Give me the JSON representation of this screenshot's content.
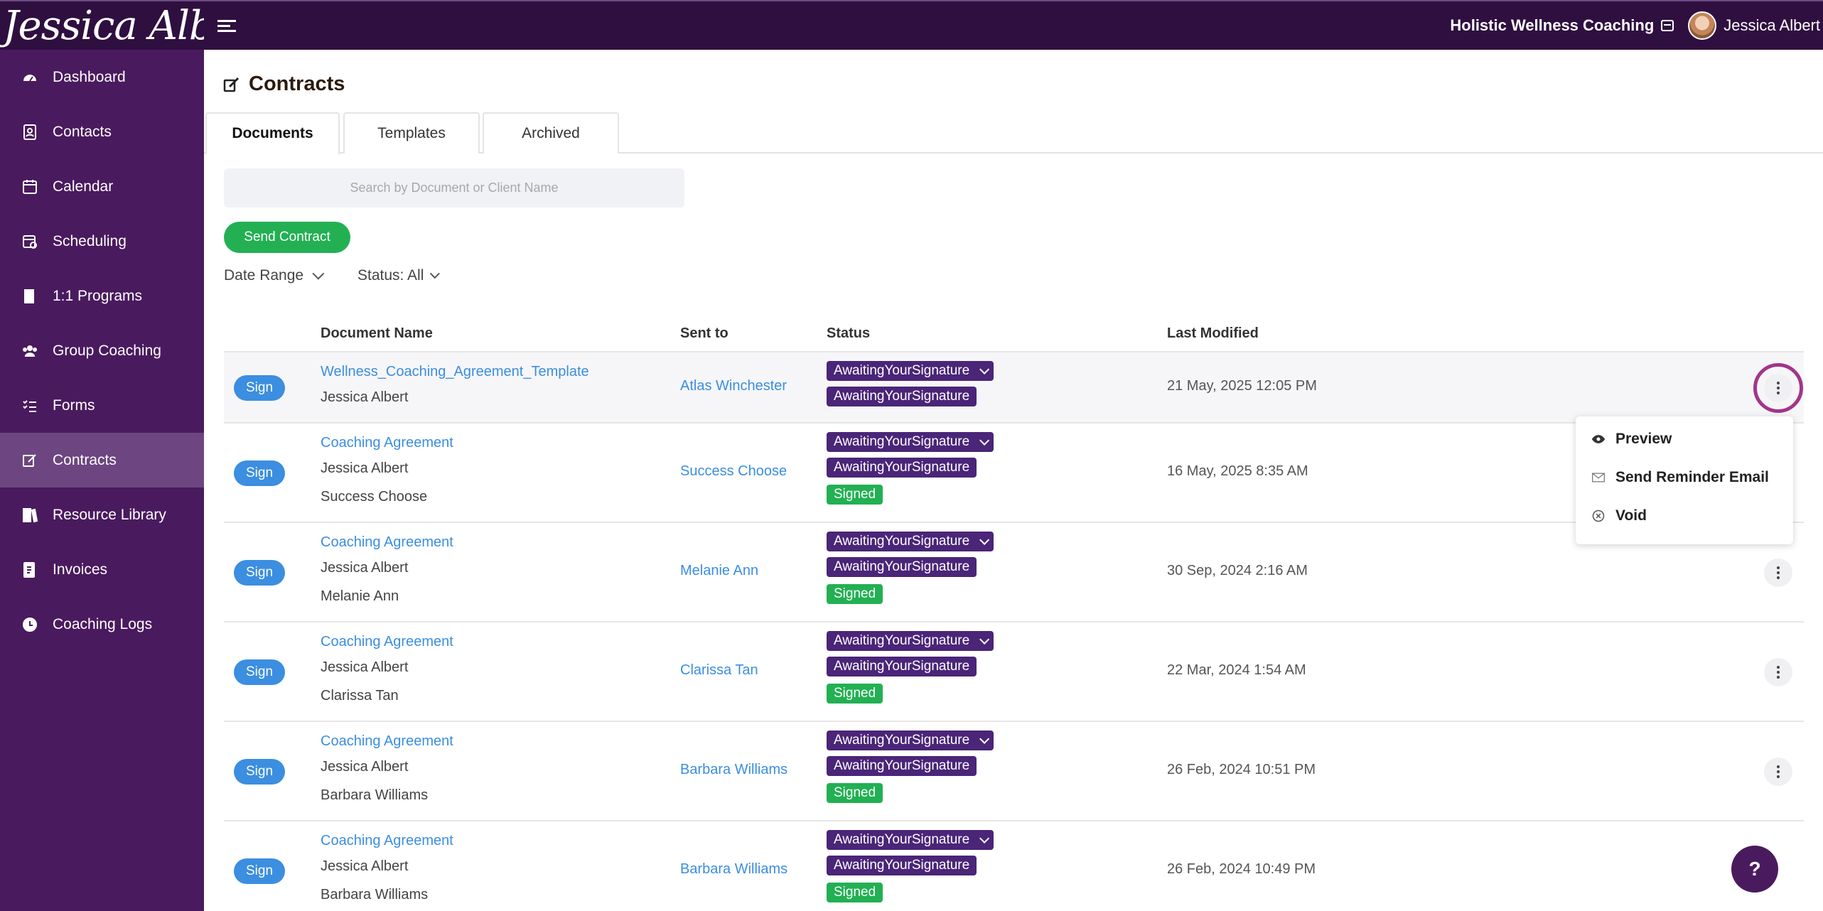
{
  "brand": {
    "name": "Jessica Albert"
  },
  "topbar": {
    "org_name": "Holistic Wellness Coaching",
    "user_name": "Jessica Albert"
  },
  "sidebar": {
    "items": [
      {
        "label": "Dashboard",
        "icon": "gauge-icon"
      },
      {
        "label": "Contacts",
        "icon": "contact-card-icon"
      },
      {
        "label": "Calendar",
        "icon": "calendar-icon"
      },
      {
        "label": "Scheduling",
        "icon": "scheduling-icon"
      },
      {
        "label": "1:1 Programs",
        "icon": "book-icon"
      },
      {
        "label": "Group Coaching",
        "icon": "group-icon"
      },
      {
        "label": "Forms",
        "icon": "checklist-icon"
      },
      {
        "label": "Contracts",
        "icon": "signature-icon",
        "active": true
      },
      {
        "label": "Resource Library",
        "icon": "books-icon"
      },
      {
        "label": "Invoices",
        "icon": "invoice-icon"
      },
      {
        "label": "Coaching Logs",
        "icon": "clock-icon"
      }
    ]
  },
  "page": {
    "title": "Contracts"
  },
  "tabs": [
    {
      "label": "Documents",
      "active": true
    },
    {
      "label": "Templates"
    },
    {
      "label": "Archived"
    }
  ],
  "search": {
    "placeholder": "Search by Document or Client Name"
  },
  "actions": {
    "send_contract": "Send Contract"
  },
  "filters": {
    "date_range": "Date Range",
    "status": "Status: All"
  },
  "table": {
    "headers": {
      "document_name": "Document Name",
      "sent_to": "Sent to",
      "status": "Status",
      "last_modified": "Last Modified"
    },
    "sign_label": "Sign",
    "rows": [
      {
        "doc": "Wellness_Coaching_Agreement_Template",
        "signers": [
          "Jessica Albert"
        ],
        "sent_to": "Atlas Winchester",
        "statuses": [
          "AwaitingYourSignature",
          "AwaitingYourSignature"
        ],
        "modified": "21 May, 2025 12:05 PM"
      },
      {
        "doc": "Coaching Agreement",
        "signers": [
          "Jessica Albert",
          "Success Choose"
        ],
        "sent_to": "Success Choose",
        "statuses": [
          "AwaitingYourSignature",
          "AwaitingYourSignature",
          "Signed"
        ],
        "modified": "16 May, 2025 8:35 AM"
      },
      {
        "doc": "Coaching Agreement",
        "signers": [
          "Jessica Albert",
          "Melanie Ann"
        ],
        "sent_to": "Melanie Ann",
        "statuses": [
          "AwaitingYourSignature",
          "AwaitingYourSignature",
          "Signed"
        ],
        "modified": "30 Sep, 2024 2:16 AM"
      },
      {
        "doc": "Coaching Agreement",
        "signers": [
          "Jessica Albert",
          "Clarissa Tan"
        ],
        "sent_to": "Clarissa Tan",
        "statuses": [
          "AwaitingYourSignature",
          "AwaitingYourSignature",
          "Signed"
        ],
        "modified": "22 Mar, 2024 1:54 AM"
      },
      {
        "doc": "Coaching Agreement",
        "signers": [
          "Jessica Albert",
          "Barbara Williams"
        ],
        "sent_to": "Barbara Williams",
        "statuses": [
          "AwaitingYourSignature",
          "AwaitingYourSignature",
          "Signed"
        ],
        "modified": "26 Feb, 2024 10:51 PM"
      },
      {
        "doc": "Coaching Agreement",
        "signers": [
          "Jessica Albert",
          "Barbara Williams"
        ],
        "sent_to": "Barbara Williams",
        "statuses": [
          "AwaitingYourSignature",
          "AwaitingYourSignature",
          "Signed"
        ],
        "modified": "26 Feb, 2024 10:49 PM"
      }
    ]
  },
  "dropdown": {
    "items": [
      {
        "label": "Preview",
        "icon": "eye-icon"
      },
      {
        "label": "Send Reminder Email",
        "icon": "envelope-icon"
      },
      {
        "label": "Void",
        "icon": "circle-x-icon"
      }
    ]
  },
  "help": {
    "label": "?"
  },
  "colors": {
    "topbar": "#2f0f40",
    "sidebar": "#4a1a5e",
    "sidebar_active": "#6d4681",
    "link": "#3b8ee0",
    "badge_purple": "#4a2578",
    "badge_green": "#22b053",
    "focus_ring": "#a2358a"
  }
}
